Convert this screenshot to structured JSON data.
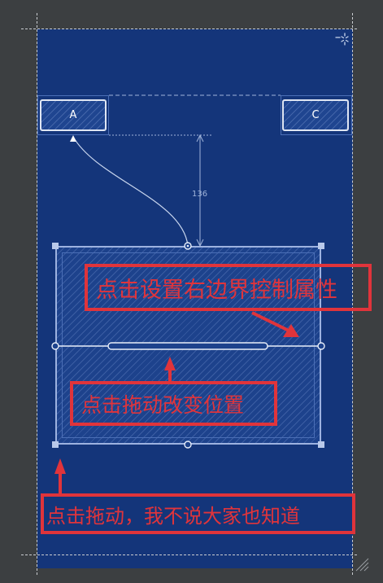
{
  "widgets": {
    "a": {
      "label": "A"
    },
    "c": {
      "label": "C"
    }
  },
  "selected_widget": {
    "constraint_distance": "136"
  },
  "annotations": {
    "right_edge": "点击设置右边界控制属性",
    "drag_move": "点击拖动改变位置",
    "drag_resize": "点击拖动，我不说大家也知道"
  },
  "colors": {
    "editor_background": "#3c3f41",
    "blueprint": "#14357a",
    "widget_fill": "#1f4590",
    "annotation_red": "#e0343b"
  },
  "icons": {
    "top_right": "loading-spinner-icon",
    "bottom_right": "resize-grip-icon"
  }
}
